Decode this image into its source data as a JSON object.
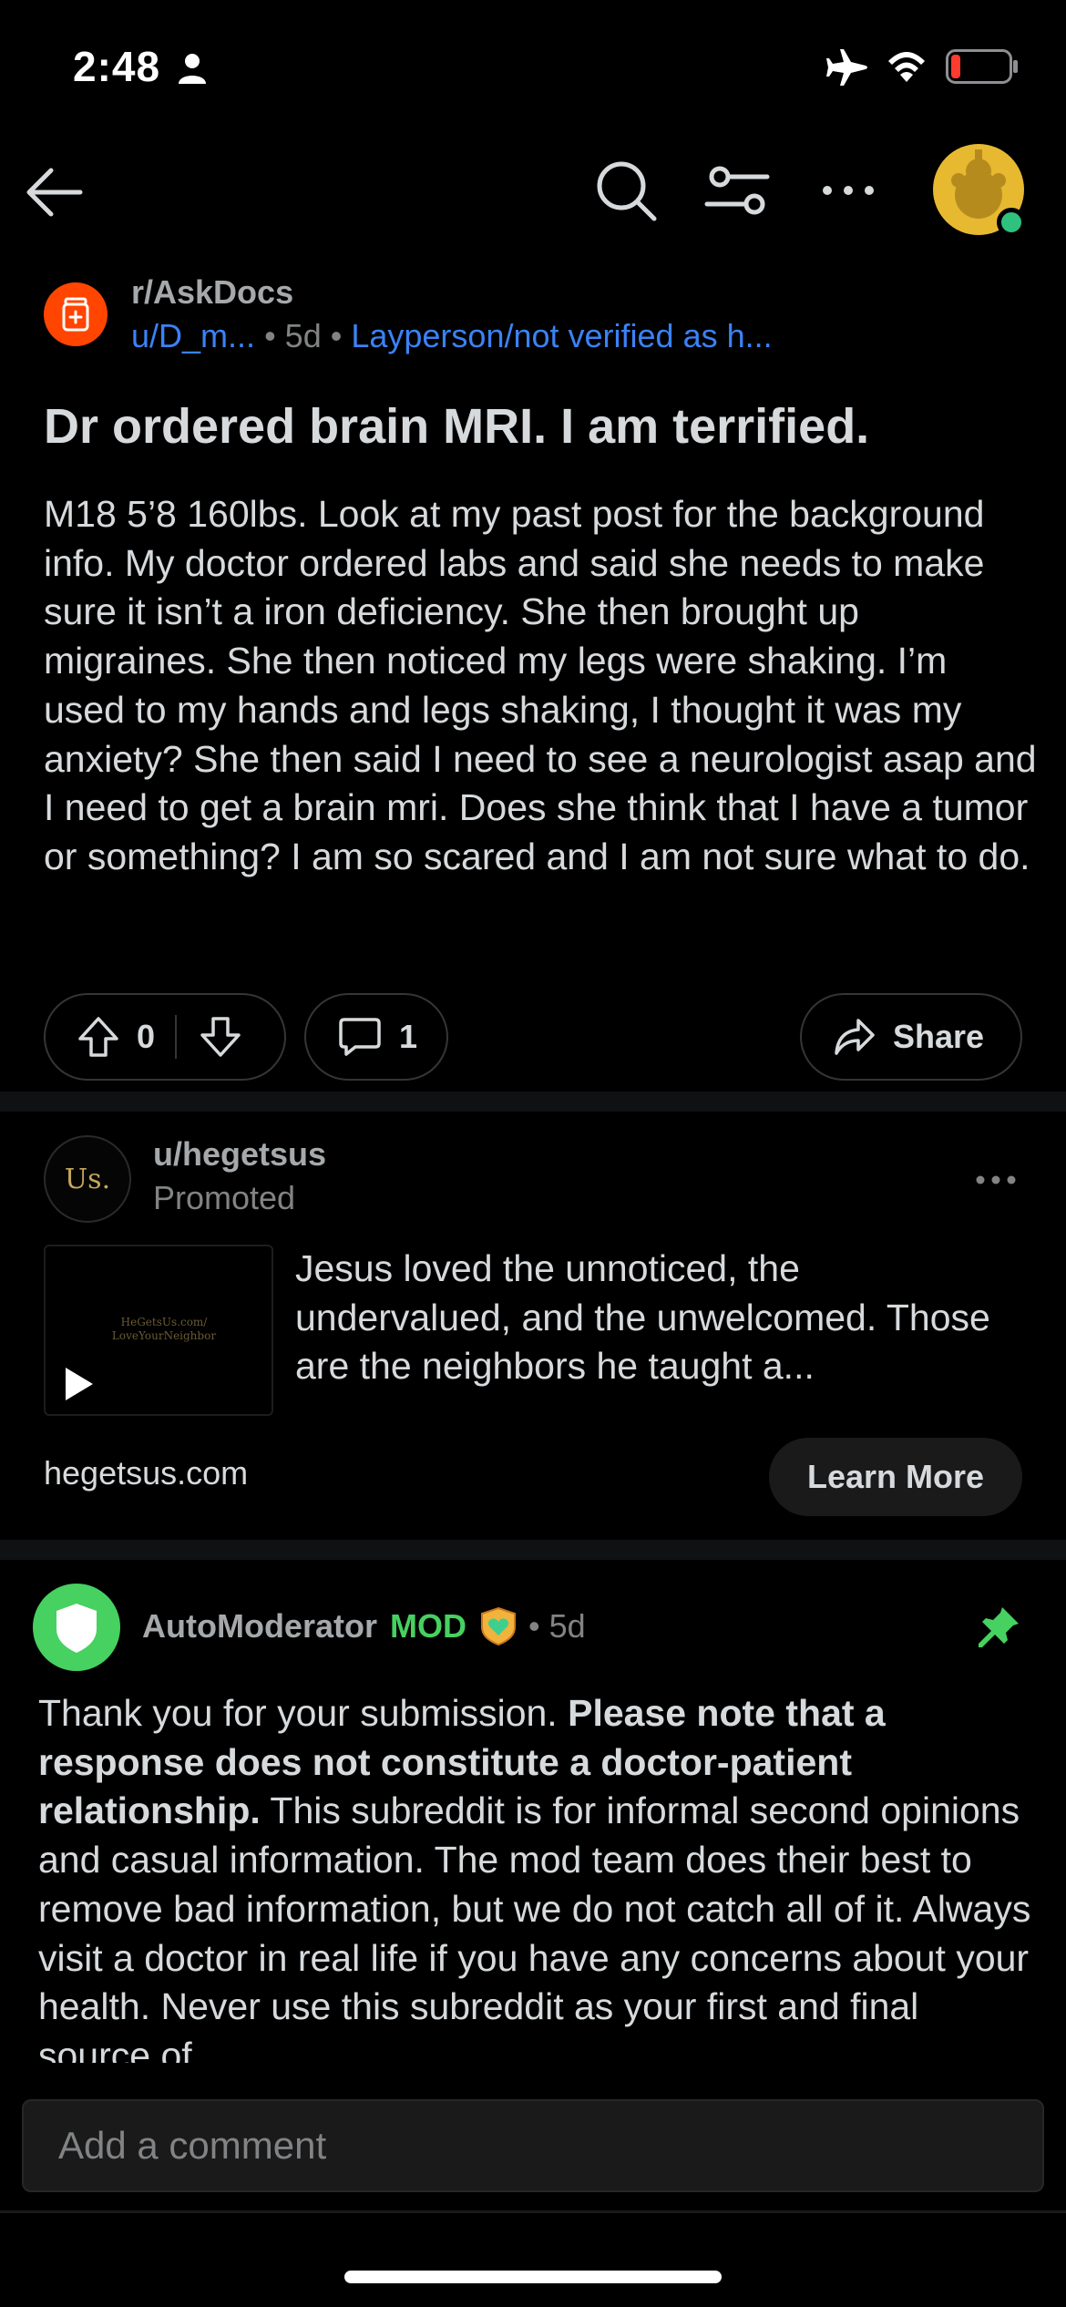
{
  "status_bar": {
    "time": "2:48",
    "battery_color": "#ff3b30"
  },
  "nav": {
    "back_icon": "back-arrow-icon",
    "search_icon": "search-icon",
    "filter_icon": "filter-icon",
    "more_icon": "more-icon"
  },
  "post": {
    "subreddit": "r/AskDocs",
    "author": "u/D_m...",
    "age": "5d",
    "flair": "Layperson/not verified as h...",
    "title": "Dr ordered brain MRI. I am terrified.",
    "body": "M18 5’8 160lbs. Look at my past post for the background info. My doctor ordered labs and said she needs to make sure it isn’t a iron deficiency. She then brought up migraines. She then noticed my legs were shaking. I’m used to my hands and legs shaking, I thought it was my anxiety? She then said I need to see a neurologist asap and I need to get a brain mri. Does she think that I have a tumor or something? I am so scared and I am not sure what to do.",
    "vote_count": "0",
    "comment_count": "1",
    "share_label": "Share"
  },
  "ad": {
    "avatar_text": "Us.",
    "user": "u/hegetsus",
    "promoted_label": "Promoted",
    "thumb_text": "HeGetsUs.com/ LoveYourNeighbor",
    "text": "Jesus loved the unnoticed, the undervalued, and the unwelcomed. Those are the neighbors he taught a...",
    "domain": "hegetsus.com",
    "cta": "Learn More"
  },
  "comment": {
    "author": "AutoModerator",
    "badge": "MOD",
    "age": "5d",
    "body_intro": "Thank you for your submission. ",
    "body_bold": "Please note that a response does not constitute a doctor-patient relationship.",
    "body_rest": " This subreddit is for informal second opinions and casual information. The mod team does their best to remove bad information, but we do not catch all of it. Always visit a doctor in real life if you have any concerns about your health. Never use this subreddit as your first and final source of"
  },
  "composer": {
    "placeholder": "Add a comment"
  },
  "colors": {
    "background": "#000000",
    "link_blue": "#3b82f6",
    "mod_green": "#46d160",
    "subreddit_orange": "#ff4500"
  }
}
